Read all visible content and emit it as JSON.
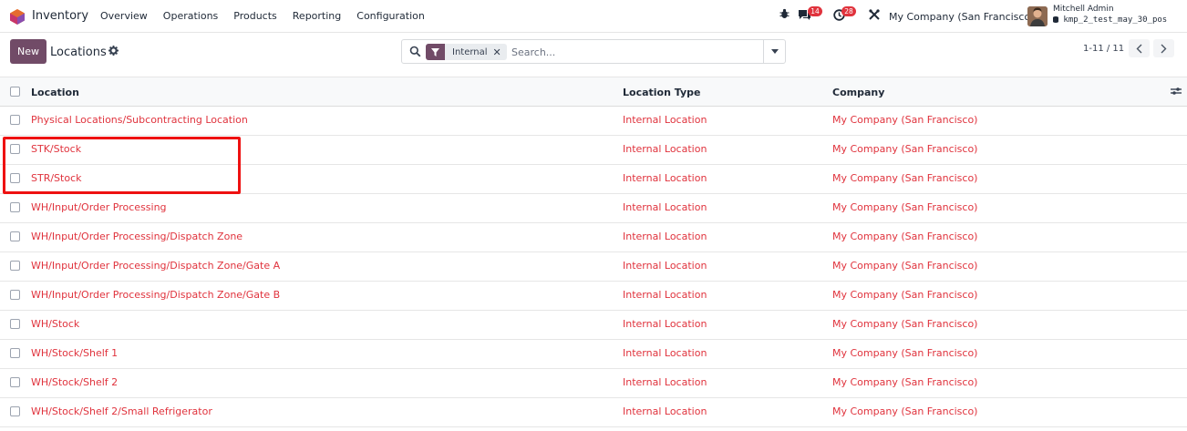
{
  "navbar": {
    "app_name": "Inventory",
    "menu": [
      "Overview",
      "Operations",
      "Products",
      "Reporting",
      "Configuration"
    ],
    "messages_count": "14",
    "activities_count": "28",
    "company": "My Company (San Francisco)",
    "user_name": "Mitchell Admin",
    "database": "kmp_2_test_may_30_pos"
  },
  "control_panel": {
    "new_label": "New",
    "title": "Locations",
    "search_facet": "Internal",
    "search_placeholder": "Search...",
    "pager": "1-11 / 11"
  },
  "table": {
    "columns": [
      "Location",
      "Location Type",
      "Company"
    ],
    "rows": [
      {
        "location": "Physical Locations/Subcontracting Location",
        "type": "Internal Location",
        "company": "My Company (San Francisco)"
      },
      {
        "location": "STK/Stock",
        "type": "Internal Location",
        "company": "My Company (San Francisco)"
      },
      {
        "location": "STR/Stock",
        "type": "Internal Location",
        "company": "My Company (San Francisco)"
      },
      {
        "location": "WH/Input/Order Processing",
        "type": "Internal Location",
        "company": "My Company (San Francisco)"
      },
      {
        "location": "WH/Input/Order Processing/Dispatch Zone",
        "type": "Internal Location",
        "company": "My Company (San Francisco)"
      },
      {
        "location": "WH/Input/Order Processing/Dispatch Zone/Gate A",
        "type": "Internal Location",
        "company": "My Company (San Francisco)"
      },
      {
        "location": "WH/Input/Order Processing/Dispatch Zone/Gate B",
        "type": "Internal Location",
        "company": "My Company (San Francisco)"
      },
      {
        "location": "WH/Stock",
        "type": "Internal Location",
        "company": "My Company (San Francisco)"
      },
      {
        "location": "WH/Stock/Shelf 1",
        "type": "Internal Location",
        "company": "My Company (San Francisco)"
      },
      {
        "location": "WH/Stock/Shelf 2",
        "type": "Internal Location",
        "company": "My Company (San Francisco)"
      },
      {
        "location": "WH/Stock/Shelf 2/Small Refrigerator",
        "type": "Internal Location",
        "company": "My Company (San Francisco)"
      }
    ]
  },
  "colors": {
    "brand": "#714b67",
    "link": "#e0333d",
    "badge": "#e0333d",
    "highlight": "#ee1111"
  },
  "icons": [
    "app-logo-icon",
    "bug-icon",
    "chat-icon",
    "clock-icon",
    "tools-icon",
    "gear-icon",
    "search-icon",
    "filter-icon",
    "close-icon",
    "caret-down-icon",
    "chevron-left-icon",
    "chevron-right-icon",
    "column-settings-icon"
  ]
}
